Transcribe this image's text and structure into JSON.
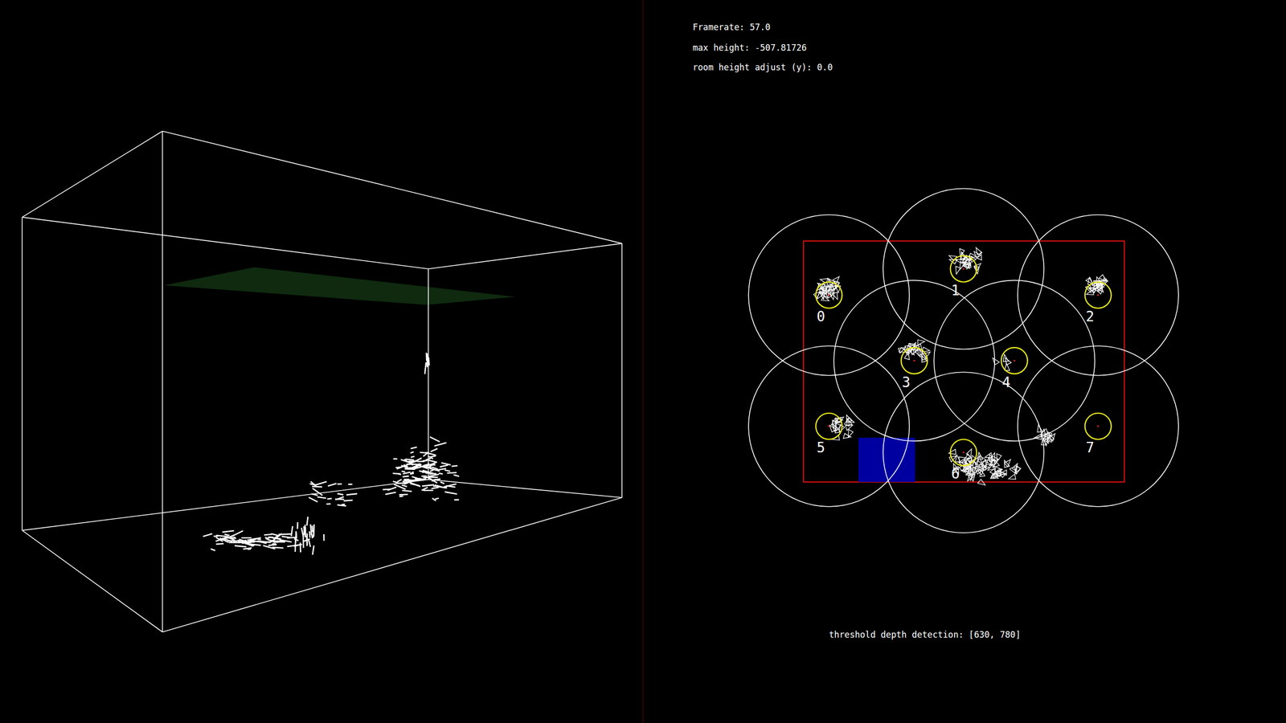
{
  "hud": {
    "framerate": "Framerate: 57.0",
    "max_height": "max height: -507.81726",
    "room_height": "room height adjust (y): 0.0"
  },
  "threshold": "threshold depth detection: [630, 780]",
  "zones": [
    {
      "label": "0"
    },
    {
      "label": "1"
    },
    {
      "label": "2"
    },
    {
      "label": "3"
    },
    {
      "label": "4"
    },
    {
      "label": "5"
    },
    {
      "label": "6"
    },
    {
      "label": "7"
    }
  ]
}
